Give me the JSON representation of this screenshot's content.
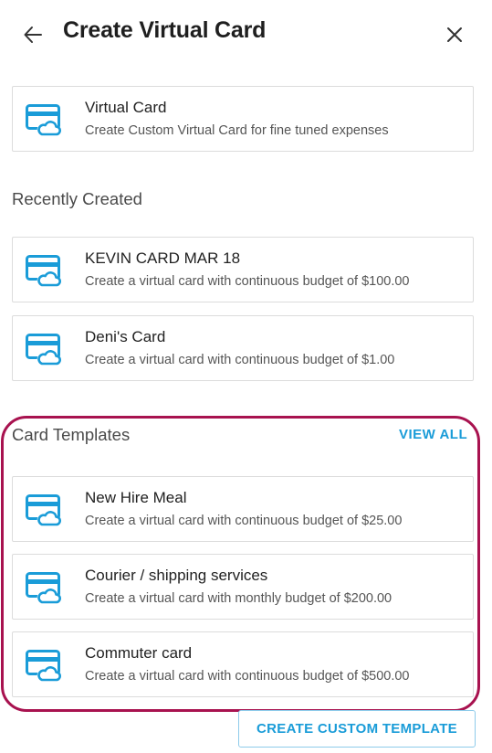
{
  "header": {
    "title": "Create Virtual Card",
    "back_icon": "arrow-left-icon",
    "close_icon": "close-icon"
  },
  "virtual_card": {
    "title": "Virtual Card",
    "description": "Create Custom Virtual Card for fine tuned expenses",
    "icon": "card-cloud-icon"
  },
  "recently_created": {
    "heading": "Recently Created",
    "items": [
      {
        "title": "KEVIN CARD MAR 18",
        "description": "Create a virtual card with continuous budget of $100.00",
        "icon": "card-cloud-icon"
      },
      {
        "title": "Deni's Card",
        "description": "Create a virtual card with continuous budget of $1.00",
        "icon": "card-cloud-icon"
      }
    ]
  },
  "card_templates": {
    "heading": "Card Templates",
    "view_all_label": "VIEW ALL",
    "items": [
      {
        "title": "New Hire Meal",
        "description": "Create a virtual card with continuous budget of $25.00",
        "icon": "card-cloud-icon"
      },
      {
        "title": "Courier / shipping services",
        "description": "Create a virtual card with monthly budget of $200.00",
        "icon": "card-cloud-icon"
      },
      {
        "title": "Commuter card",
        "description": "Create a virtual card with continuous budget of $500.00",
        "icon": "card-cloud-icon"
      }
    ]
  },
  "footer": {
    "create_custom_template_label": "CREATE CUSTOM TEMPLATE"
  },
  "colors": {
    "accent": "#1a9cd8",
    "highlight": "#a8124f",
    "border": "#dcdcdc"
  }
}
